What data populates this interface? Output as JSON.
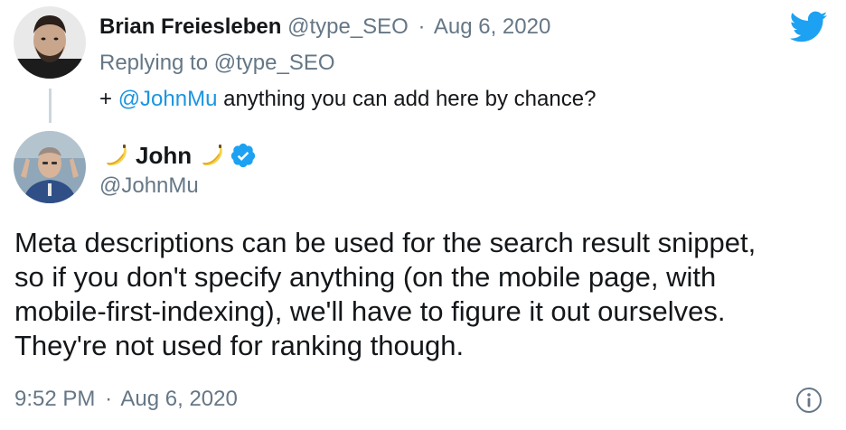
{
  "parent_tweet": {
    "display_name": "Brian Freiesleben",
    "handle": "@type_SEO",
    "separator": "·",
    "date": "Aug 6, 2020",
    "replying_prefix": "Replying to",
    "replying_to": "@type_SEO",
    "text_prefix": "+",
    "mention": "@JohnMu",
    "text_rest": "anything you can add here by chance?",
    "avatar_icon": "person-photo-avatar"
  },
  "reply_tweet": {
    "display_name": "John",
    "name_emoji": "banana-emoji",
    "verified_icon": "verified-badge-icon",
    "verified_color": "#1da1f2",
    "handle": "@JohnMu",
    "body_lines": [
      "Meta descriptions can be used for the search result snippet,",
      "so if you don't specify anything (on the mobile page, with",
      "mobile-first-indexing), we'll have to figure it out ourselves.",
      "They're not used for ranking though."
    ],
    "time": "9:52 PM",
    "separator": "·",
    "date": "Aug 6, 2020",
    "avatar_icon": "person-photo-avatar"
  },
  "icons": {
    "logo": "twitter-bird-icon",
    "info": "info-icon"
  },
  "colors": {
    "link": "#1b95e0",
    "muted": "#657786",
    "text": "#14171a",
    "brand": "#1da1f2",
    "thread_line": "#ccd6dd"
  }
}
